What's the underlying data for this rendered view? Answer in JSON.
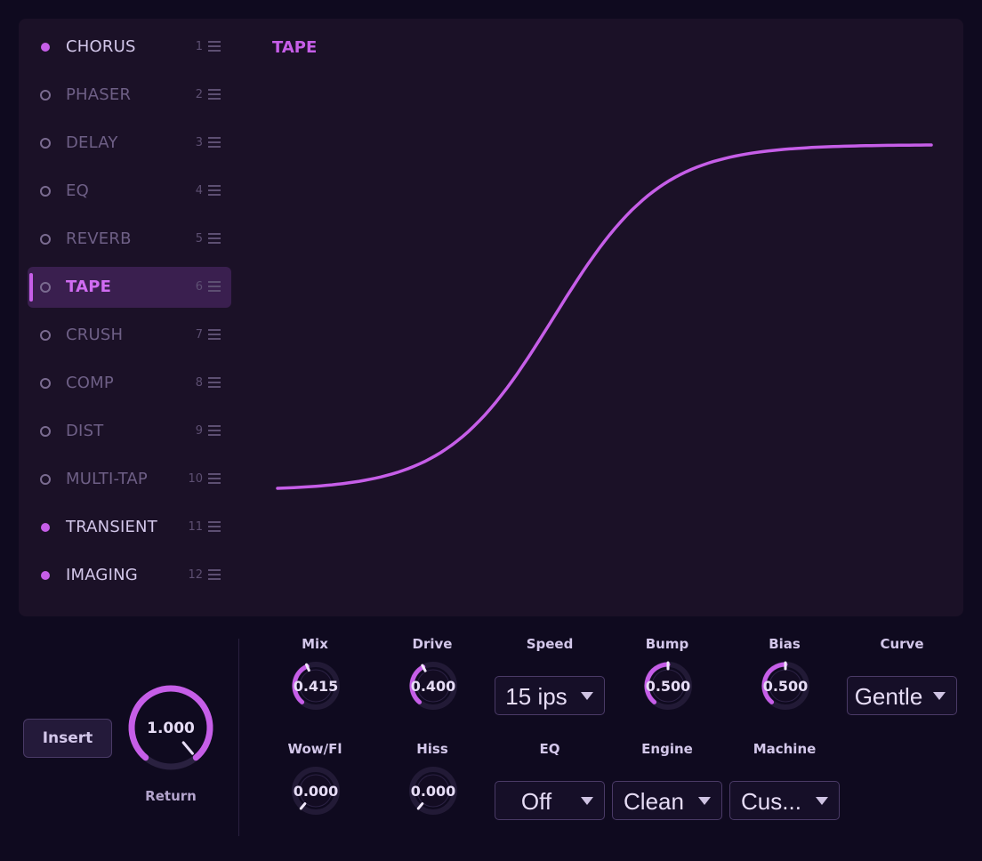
{
  "effects": [
    {
      "label": "CHORUS",
      "num": "1",
      "active": true
    },
    {
      "label": "PHASER",
      "num": "2",
      "active": false
    },
    {
      "label": "DELAY",
      "num": "3",
      "active": false
    },
    {
      "label": "EQ",
      "num": "4",
      "active": false
    },
    {
      "label": "REVERB",
      "num": "5",
      "active": false
    },
    {
      "label": "TAPE",
      "num": "6",
      "active": false,
      "selected": true
    },
    {
      "label": "CRUSH",
      "num": "7",
      "active": false
    },
    {
      "label": "COMP",
      "num": "8",
      "active": false
    },
    {
      "label": "DIST",
      "num": "9",
      "active": false
    },
    {
      "label": "MULTI-TAP",
      "num": "10",
      "active": false
    },
    {
      "label": "TRANSIENT",
      "num": "11",
      "active": true
    },
    {
      "label": "IMAGING",
      "num": "12",
      "active": true
    }
  ],
  "curve": {
    "title": "TAPE",
    "type": "saturation-curve"
  },
  "insert_label": "Insert",
  "return_knob": {
    "label": "Return",
    "value": "1.000",
    "fraction": 1.0
  },
  "controls": {
    "mix": {
      "label": "Mix",
      "value": "0.415",
      "fraction": 0.415
    },
    "drive": {
      "label": "Drive",
      "value": "0.400",
      "fraction": 0.4
    },
    "speed": {
      "label": "Speed",
      "value": "15 ips"
    },
    "bump": {
      "label": "Bump",
      "value": "0.500",
      "fraction": 0.5
    },
    "bias": {
      "label": "Bias",
      "value": "0.500",
      "fraction": 0.5
    },
    "curve_sel": {
      "label": "Curve",
      "value": "Gentle"
    },
    "wow": {
      "label": "Wow/Fl",
      "value": "0.000",
      "fraction": 0.0
    },
    "hiss": {
      "label": "Hiss",
      "value": "0.000",
      "fraction": 0.0
    },
    "eq": {
      "label": "EQ",
      "value": "Off"
    },
    "engine": {
      "label": "Engine",
      "value": "Clean"
    },
    "machine": {
      "label": "Machine",
      "value": "Cus..."
    }
  },
  "colors": {
    "accent": "#c65ee8",
    "track": "#2a2140",
    "text": "#d3c7ea"
  }
}
